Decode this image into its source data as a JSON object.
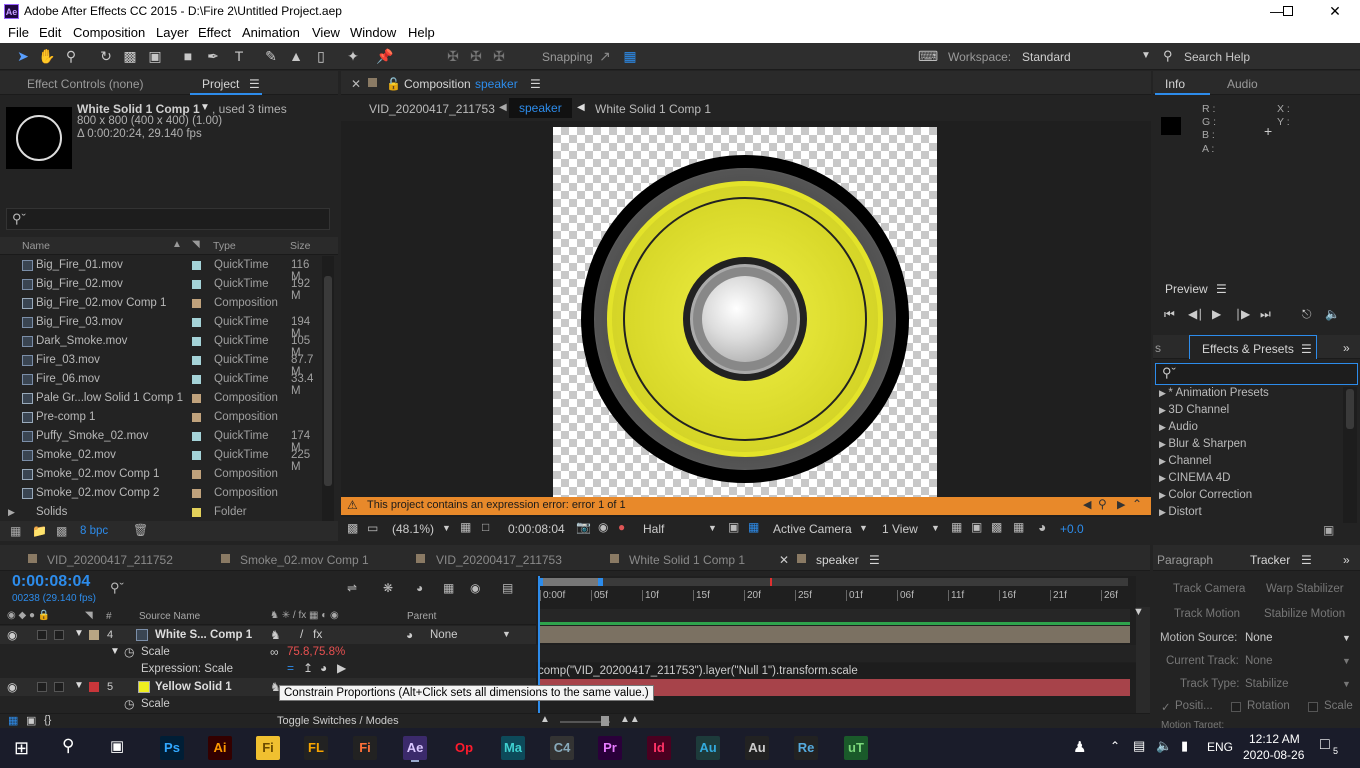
{
  "window": {
    "app_icon": "Ae",
    "title": "Adobe After Effects CC 2015 - D:\\Fire 2\\Untitled Project.aep",
    "controls": [
      "minimize",
      "maximize",
      "close"
    ]
  },
  "menu": [
    "File",
    "Edit",
    "Composition",
    "Layer",
    "Effect",
    "Animation",
    "View",
    "Window",
    "Help"
  ],
  "toolbar": {
    "snapping_label": "Snapping",
    "workspace_label": "Workspace:",
    "workspace_value": "Standard",
    "search_help_placeholder": "Search Help"
  },
  "project_panel": {
    "tabs": [
      {
        "label": "Effect Controls (none)",
        "active": false
      },
      {
        "label": "Project",
        "active": true
      }
    ],
    "selected_item": {
      "name": "White Solid 1 Comp 1",
      "used": ", used 3 times",
      "dims": "800 x 800  (400 x 400) (1.00)",
      "duration": "Δ 0:00:20:24, 29.140 fps"
    },
    "search_placeholder": "",
    "columns": [
      "Name",
      "Type",
      "Size"
    ],
    "items": [
      {
        "name": "Big_Fire_01.mov",
        "type": "QuickTime",
        "size": "116 M",
        "label": "#a5d3d8",
        "kind": "footage"
      },
      {
        "name": "Big_Fire_02.mov",
        "type": "QuickTime",
        "size": "192 M",
        "label": "#a5d3d8",
        "kind": "footage"
      },
      {
        "name": "Big_Fire_02.mov Comp 1",
        "type": "Composition",
        "size": "",
        "label": "#c0a27c",
        "kind": "comp"
      },
      {
        "name": "Big_Fire_03.mov",
        "type": "QuickTime",
        "size": "194 M",
        "label": "#a5d3d8",
        "kind": "footage"
      },
      {
        "name": "Dark_Smoke.mov",
        "type": "QuickTime",
        "size": "105 M",
        "label": "#a5d3d8",
        "kind": "footage"
      },
      {
        "name": "Fire_03.mov",
        "type": "QuickTime",
        "size": "87.7 M",
        "label": "#a5d3d8",
        "kind": "footage"
      },
      {
        "name": "Fire_06.mov",
        "type": "QuickTime",
        "size": "33.4 M",
        "label": "#a5d3d8",
        "kind": "footage"
      },
      {
        "name": "Pale Gr...low Solid 1 Comp 1",
        "type": "Composition",
        "size": "",
        "label": "#c0a27c",
        "kind": "comp"
      },
      {
        "name": "Pre-comp 1",
        "type": "Composition",
        "size": "",
        "label": "#c0a27c",
        "kind": "comp"
      },
      {
        "name": "Puffy_Smoke_02.mov",
        "type": "QuickTime",
        "size": "174 M",
        "label": "#a5d3d8",
        "kind": "footage"
      },
      {
        "name": "Smoke_02.mov",
        "type": "QuickTime",
        "size": "225 M",
        "label": "#a5d3d8",
        "kind": "footage"
      },
      {
        "name": "Smoke_02.mov Comp 1",
        "type": "Composition",
        "size": "",
        "label": "#c0a27c",
        "kind": "comp"
      },
      {
        "name": "Smoke_02.mov Comp 2",
        "type": "Composition",
        "size": "",
        "label": "#c0a27c",
        "kind": "comp"
      },
      {
        "name": "Solids",
        "type": "Folder",
        "size": "",
        "label": "#e3d15a",
        "kind": "folder"
      }
    ],
    "bpc": "8 bpc"
  },
  "composition_panel": {
    "tab_prefix": "Composition",
    "tab_comp": "speaker",
    "breadcrumbs": [
      "VID_20200417_211753",
      "speaker",
      "White Solid 1 Comp 1"
    ],
    "active_breadcrumb": 1,
    "error_text": "This project contains an expression error: error 1 of 1",
    "zoom": "(48.1%)",
    "timecode": "0:00:08:04",
    "resolution": "Half",
    "camera": "Active Camera",
    "views": "1 View",
    "exposure": "+0.0"
  },
  "info_panel": {
    "tabs": [
      {
        "label": "Info",
        "active": true
      },
      {
        "label": "Audio",
        "active": false
      }
    ],
    "labels": [
      "R :",
      "G :",
      "B :",
      "A :"
    ],
    "xy": [
      "X :",
      "Y :"
    ]
  },
  "preview_panel": {
    "title": "Preview"
  },
  "effects_panel": {
    "tab_label": "Effects & Presets",
    "partial_tab": "s",
    "items": [
      "* Animation Presets",
      "3D Channel",
      "Audio",
      "Blur & Sharpen",
      "Channel",
      "CINEMA 4D",
      "Color Correction",
      "Distort"
    ]
  },
  "timeline": {
    "tabs": [
      {
        "label": "VID_20200417_211752",
        "color": "#8a7a64"
      },
      {
        "label": "Smoke_02.mov Comp 1",
        "color": "#8a7a64"
      },
      {
        "label": "VID_20200417_211753",
        "color": "#8a7a64"
      },
      {
        "label": "White Solid 1 Comp 1",
        "color": "#8a7a64"
      },
      {
        "label": "speaker",
        "color": "#8a7a64",
        "active": true
      }
    ],
    "timecode": "0:00:08:04",
    "frame_info": "00238 (29.140 fps)",
    "columns": {
      "num": "#",
      "source": "Source Name",
      "parent": "Parent"
    },
    "ruler": [
      "0:00f",
      "05f",
      "10f",
      "15f",
      "20f",
      "25f",
      "01f",
      "06f",
      "11f",
      "16f",
      "21f",
      "26f"
    ],
    "layers": [
      {
        "num": "4",
        "name": "White S... Comp 1",
        "label": "#b8a584",
        "parent": "None"
      },
      {
        "num": "5",
        "name": "Yellow Solid 1",
        "label": "#c8363a",
        "parent": "None"
      }
    ],
    "scale_label": "Scale",
    "scale_value": "75.8,75.8%",
    "expression_label": "Expression: Scale",
    "expression_text": "comp(\"VID_20200417_211753\").layer(\"Null 1\").transform.scale",
    "tooltip": "Constrain Proportions (Alt+Click sets all dimensions to the same value.)",
    "toggle_label": "Toggle Switches / Modes"
  },
  "right_bottom": {
    "tabs": [
      {
        "label": "Paragraph",
        "active": false
      },
      {
        "label": "Tracker",
        "active": true
      }
    ],
    "buttons": [
      "Track Camera",
      "Warp Stabilizer",
      "Track Motion",
      "Stabilize Motion"
    ],
    "motion_source_label": "Motion Source:",
    "motion_source_value": "None",
    "current_track_label": "Current Track:",
    "current_track_value": "None",
    "track_type_label": "Track Type:",
    "track_type_value": "Stabilize",
    "checks": [
      "Positi...",
      "Rotation",
      "Scale"
    ],
    "more": "Motion Target:"
  },
  "taskbar": {
    "apps": [
      "Ps",
      "Ai",
      "Files",
      "FL",
      "Firefox",
      "Ae",
      "Opera",
      "Maya",
      "C4D",
      "Pr",
      "Id",
      "Audition",
      "Audio",
      "Resolve",
      "uTorrent"
    ],
    "lang": "ENG",
    "time": "12:12 AM",
    "date": "2020-08-26",
    "notifications": "5"
  }
}
